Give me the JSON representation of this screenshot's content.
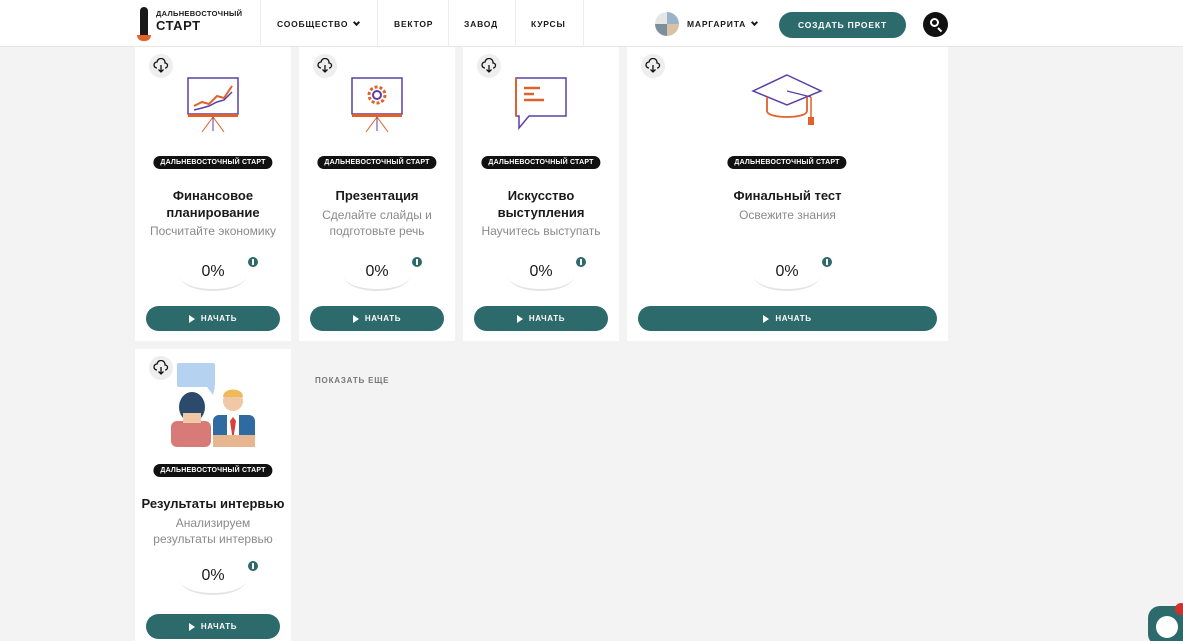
{
  "header": {
    "logo_top": "ДАЛЬНЕВОСТОЧНЫЙ",
    "logo_bottom": "СТАРТ",
    "nav": [
      "СООБЩЕСТВО",
      "ВЕКТОР",
      "ЗАВОД",
      "КУРСЫ"
    ],
    "user_name": "МАРГАРИТА",
    "create_label": "СОЗДАТЬ ПРОЕКТ"
  },
  "badge_text": "ДАЛЬНЕВОСТОЧНЫЙ СТАРТ",
  "start_label": "НАЧАТЬ",
  "show_more": "ПОКАЗАТЬ ЕЩЕ",
  "cards": [
    {
      "title": "Финансовое планирование",
      "subtitle": "Посчитайте экономику",
      "progress": "0%",
      "icon": "chart-board-icon"
    },
    {
      "title": "Презентация",
      "subtitle": "Сделайте слайды и подготовьте речь",
      "progress": "0%",
      "icon": "gear-board-icon"
    },
    {
      "title": "Искусство выступления",
      "subtitle": "Научитесь выступать",
      "progress": "0%",
      "icon": "speech-bubble-icon"
    },
    {
      "title": "Финальный тест",
      "subtitle": "Освежите знания",
      "progress": "0%",
      "icon": "graduation-cap-icon"
    },
    {
      "title": "Результаты интервью",
      "subtitle": "Анализируем результаты интервью",
      "progress": "0%",
      "icon": "interview-people-icon"
    }
  ],
  "colors": {
    "primary": "#2c6a6c",
    "accent": "#e0612a",
    "purple": "#5b3fa8"
  }
}
